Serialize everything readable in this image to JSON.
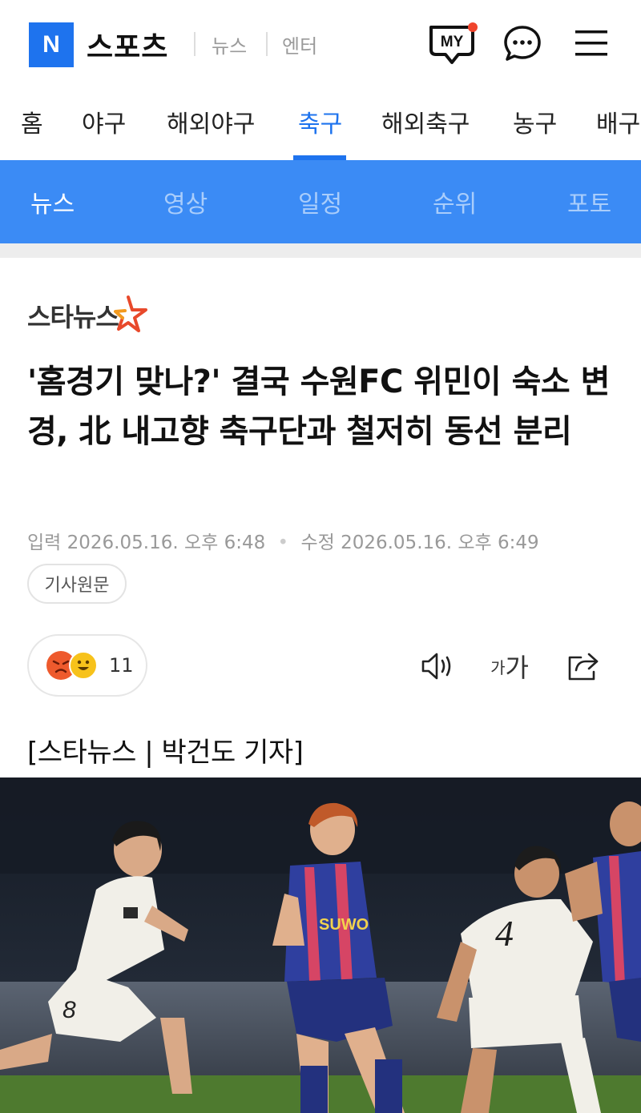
{
  "header": {
    "logo_letter": "N",
    "brand": "스포츠",
    "links": [
      "뉴스",
      "엔터"
    ],
    "my_label": "MY",
    "accent": "#1e73ee",
    "badge_color": "#f0442c"
  },
  "sport_tabs": [
    {
      "label": "홈",
      "active": false
    },
    {
      "label": "야구",
      "active": false
    },
    {
      "label": "해외야구",
      "active": false
    },
    {
      "label": "축구",
      "active": true
    },
    {
      "label": "해외축구",
      "active": false
    },
    {
      "label": "농구",
      "active": false
    },
    {
      "label": "배구",
      "active": false
    }
  ],
  "sub_tabs": [
    {
      "label": "뉴스",
      "active": true
    },
    {
      "label": "영상",
      "active": false
    },
    {
      "label": "일정",
      "active": false
    },
    {
      "label": "순위",
      "active": false
    },
    {
      "label": "포토",
      "active": false
    }
  ],
  "article": {
    "press": "스타뉴스",
    "headline": "'홈경기 맞나?' 결국 수원FC 위민이 숙소 변경, 北 내고향 축구단과 철저히 동선 분리",
    "input_label": "입력",
    "input_time": "2026.05.16. 오후 6:48",
    "edit_label": "수정",
    "edit_time": "2026.05.16. 오후 6:49",
    "origin_button": "기사원문",
    "reaction_count": "11",
    "font_small": "가",
    "font_big": "가",
    "byline": "[스타뉴스 | 박건도 기자]"
  },
  "icons": {
    "my": "my-badge-icon",
    "chat": "chat-bubble-icon",
    "menu": "hamburger-menu-icon",
    "speaker": "speaker-icon",
    "share": "share-icon",
    "press_star": "star-icon"
  }
}
